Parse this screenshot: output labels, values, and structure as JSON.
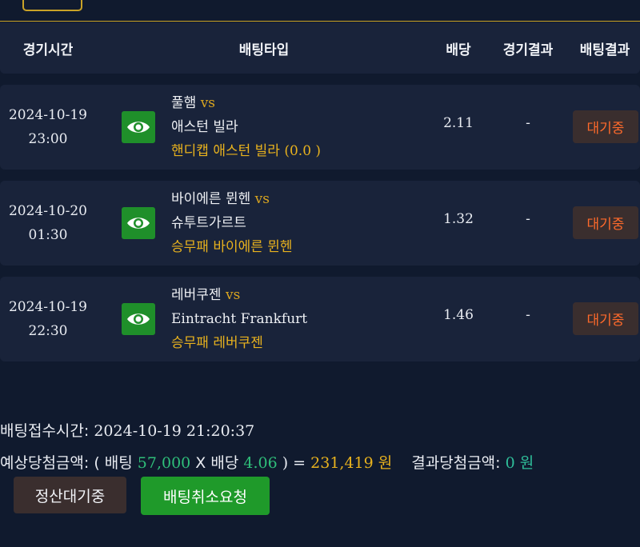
{
  "header": {
    "time": "경기시간",
    "bet_type": "배팅타입",
    "odds": "배당",
    "game_result": "경기결과",
    "bet_result": "배팅결과"
  },
  "bets": [
    {
      "date": "2024-10-19",
      "time": "23:00",
      "home": "풀햄",
      "vs": "vs",
      "away": "애스턴 빌라",
      "type_label": "핸디캡 애스턴 빌라",
      "type_extra": " (0.0 )",
      "odds": "2.11",
      "result": "-",
      "status": "대기중",
      "icon": "eye-icon"
    },
    {
      "date": "2024-10-20",
      "time": "01:30",
      "home": "바이에른 뮌헨",
      "vs": "vs",
      "away": "슈투트가르트",
      "type_label": "승무패 바이에른 뮌헨",
      "type_extra": "",
      "odds": "1.32",
      "result": "-",
      "status": "대기중",
      "icon": "eye-icon"
    },
    {
      "date": "2024-10-19",
      "time": "22:30",
      "home": "레버쿠젠",
      "vs": "vs",
      "away": "Eintracht Frankfurt",
      "type_label": "승무패 레버쿠젠",
      "type_extra": "",
      "odds": "1.46",
      "result": "-",
      "status": "대기중",
      "icon": "eye-icon"
    }
  ],
  "summary": {
    "receipt_label": "배팅접수시간:",
    "receipt_time": " 2024-10-19 21:20:37",
    "expected_label": "예상당첨금액: ( 배팅 ",
    "stake": "57,000",
    "x_odds_label": " X 배당 ",
    "total_odds": "4.06",
    "close_eq": " ) = ",
    "expected_amount": "231,419 원",
    "result_label": "결과당첨금액: ",
    "result_amount": "0 원"
  },
  "buttons": {
    "pending": "정산대기중",
    "cancel": "배팅취소요청"
  },
  "colors": {
    "background": "#101a2e",
    "panel": "#19233a",
    "accent_gold": "#e8b21e",
    "status_orange": "#ff6a2b",
    "eye_green": "#1f8f2a",
    "money_green": "#2fbf7a"
  }
}
